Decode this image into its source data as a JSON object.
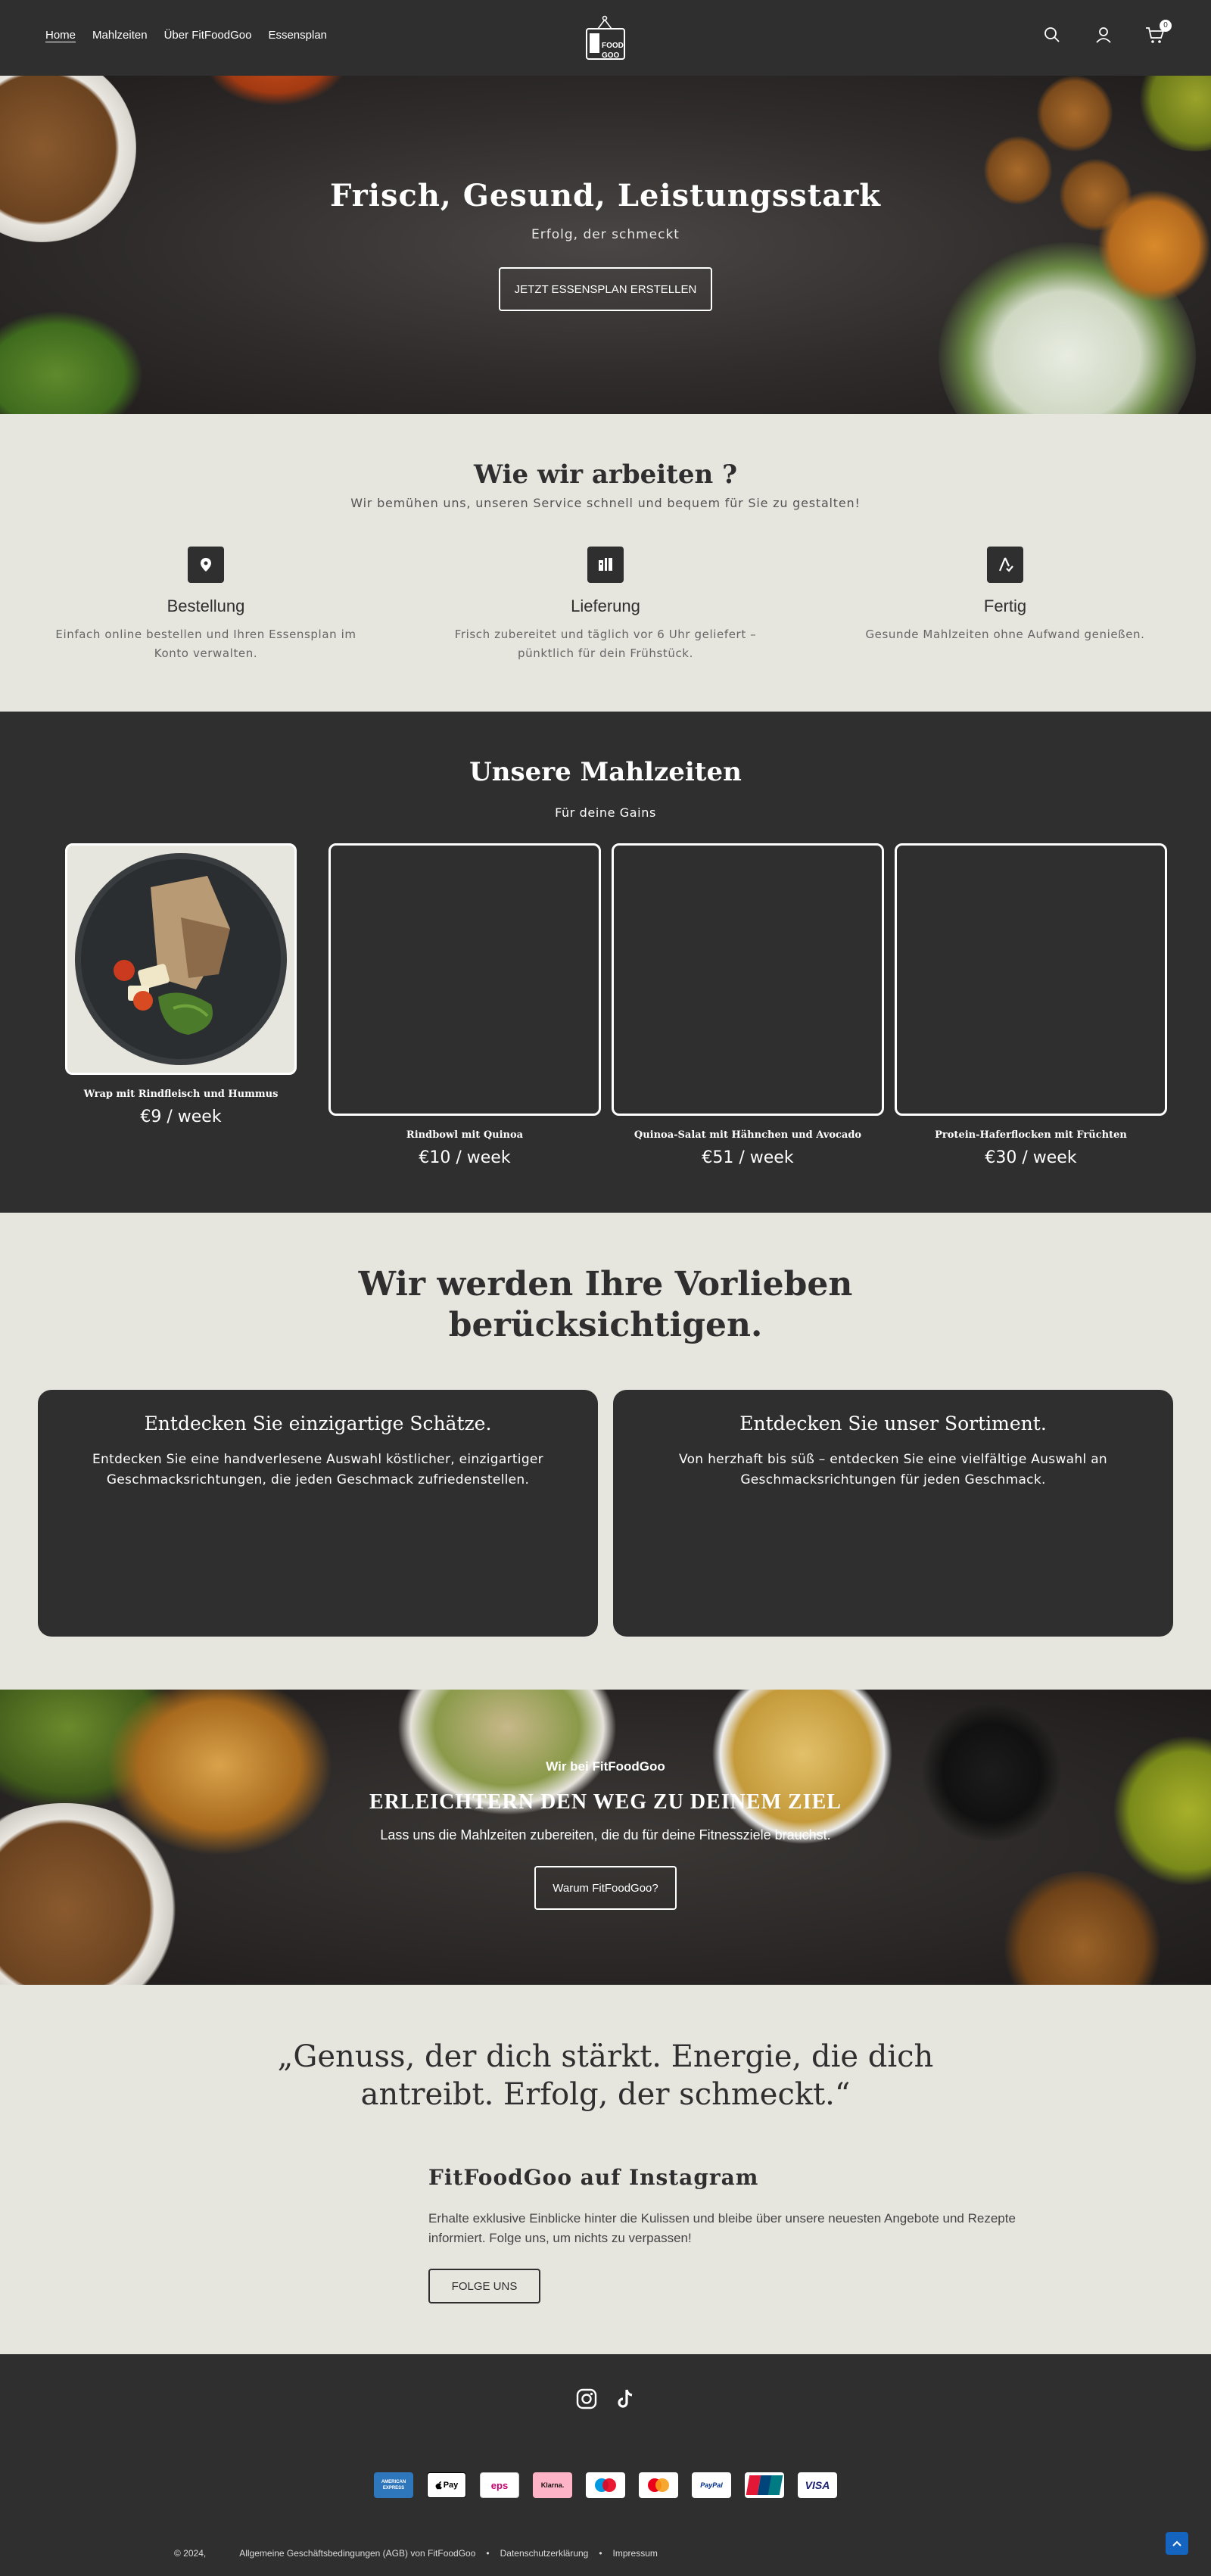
{
  "header": {
    "nav": [
      "Home",
      "Mahlzeiten",
      "Über FitFoodGoo",
      "Essensplan"
    ],
    "logo_text_top": "FOOD",
    "logo_text_bottom": "GOO",
    "cart_count": "0",
    "icons": [
      "search-icon",
      "account-icon",
      "cart-icon"
    ]
  },
  "hero": {
    "title": "Frisch, Gesund, Leistungsstark",
    "subtitle": "Erfolg, der schmeckt",
    "button": "JETZT ESSENSPLAN ERSTELLEN"
  },
  "how": {
    "title": "Wie wir arbeiten ?",
    "subtitle": "Wir bemühen uns, unseren Service schnell und bequem für Sie zu gestalten!",
    "steps": [
      {
        "icon": "location-pin-icon",
        "title": "Bestellung",
        "text": "Einfach online bestellen und Ihren Essensplan im Konto verwalten."
      },
      {
        "icon": "delivery-icon",
        "title": "Lieferung",
        "text": "Frisch zubereitet und täglich vor 6 Uhr geliefert – pünktlich für dein Frühstück."
      },
      {
        "icon": "check-icon",
        "title": "Fertig",
        "text": "Gesunde Mahlzeiten ohne Aufwand genießen."
      }
    ]
  },
  "meals": {
    "title": "Unsere Mahlzeiten",
    "subtitle": "Für deine Gains",
    "items": [
      {
        "name": "Wrap mit Rindfleisch und Hummus",
        "price": "€9 / week"
      },
      {
        "name": "Rindbowl mit Quinoa",
        "price": "€10 / week"
      },
      {
        "name": "Quinoa-Salat mit Hähnchen und Avocado",
        "price": "€51 / week"
      },
      {
        "name": "Protein-Haferflocken mit Früchten",
        "price": "€30 / week"
      }
    ]
  },
  "prefs": {
    "title_line1": "Wir werden Ihre Vorlieben",
    "title_line2": "berücksichtigen.",
    "cards": [
      {
        "title": "Entdecken Sie einzigartige Schätze.",
        "text": "Entdecken Sie eine handverlesene Auswahl köstlicher, einzigartiger Geschmacksrichtungen, die jeden Geschmack zufriedenstellen."
      },
      {
        "title": "Entdecken Sie unser Sortiment.",
        "text": "Von herzhaft bis süß – entdecken Sie eine vielfältige Auswahl an Geschmacksrichtungen für jeden Geschmack."
      }
    ]
  },
  "banner": {
    "kicker": "Wir bei FitFoodGoo",
    "title": "ERLEICHTERN DEN WEG ZU DEINEM ZIEL",
    "subtitle": "Lass uns die Mahlzeiten zubereiten, die du für deine Fitnessziele brauchst.",
    "button": "Warum FitFoodGoo?"
  },
  "quote": {
    "line1": "„Genuss, der dich stärkt. Energie, die dich",
    "line2": "antreibt. Erfolg, der schmeckt.“",
    "insta_title": "FitFoodGoo auf Instagram",
    "insta_text": "Erhalte exklusive Einblicke hinter die Kulissen und bleibe über unsere neuesten Angebote und Rezepte informiert. Folge uns, um nichts zu verpassen!",
    "insta_button": "FOLGE UNS"
  },
  "footer": {
    "socials": [
      "instagram-icon",
      "tiktok-icon"
    ],
    "payments": [
      {
        "name": "American Express",
        "label": "AMERICAN EXPRESS",
        "bg": "#2e77bc",
        "fg": "#ffffff"
      },
      {
        "name": "Apple Pay",
        "label": "Pay",
        "bg": "#ffffff",
        "fg": "#000000"
      },
      {
        "name": "eps",
        "label": "eps",
        "bg": "#ffffff",
        "fg": "#c8036f"
      },
      {
        "name": "Klarna",
        "label": "Klarna.",
        "bg": "#ffb3c7",
        "fg": "#17120f"
      },
      {
        "name": "Maestro",
        "label": "",
        "bg": "#ffffff",
        "fg": "#000000"
      },
      {
        "name": "Mastercard",
        "label": "",
        "bg": "#ffffff",
        "fg": "#000000"
      },
      {
        "name": "PayPal",
        "label": "PayPal",
        "bg": "#ffffff",
        "fg": "#003087"
      },
      {
        "name": "UnionPay",
        "label": "UnionPay",
        "bg": "#ffffff",
        "fg": "#ffffff"
      },
      {
        "name": "Visa",
        "label": "VISA",
        "bg": "#ffffff",
        "fg": "#1a1f71"
      }
    ],
    "copyright": "© 2024,",
    "links": [
      "Allgemeine Geschäftsbedingungen (AGB) von FitFoodGoo",
      "Datenschutzerklärung",
      "Impressum"
    ]
  },
  "colors": {
    "dark": "#2f2f2f",
    "cream": "#e6e5de",
    "accent_blue": "#1565c0"
  }
}
